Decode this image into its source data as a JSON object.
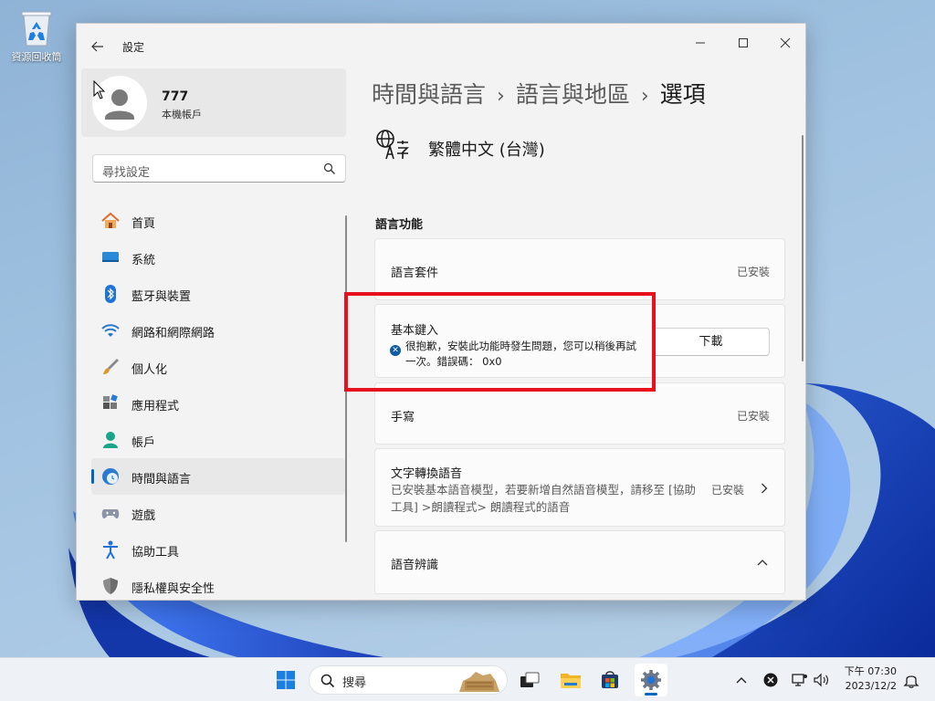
{
  "desktop": {
    "recycle_bin_label": "資源回收筒"
  },
  "window": {
    "app_title": "設定",
    "profile": {
      "name": "777",
      "subtitle": "本機帳戶"
    },
    "search_placeholder": "尋找設定",
    "nav": [
      {
        "label": "首頁",
        "icon": "home-icon",
        "active": false
      },
      {
        "label": "系統",
        "icon": "system-icon",
        "active": false
      },
      {
        "label": "藍牙與裝置",
        "icon": "bluetooth-icon",
        "active": false
      },
      {
        "label": "網路和網際網路",
        "icon": "wifi-icon",
        "active": false
      },
      {
        "label": "個人化",
        "icon": "brush-icon",
        "active": false
      },
      {
        "label": "應用程式",
        "icon": "apps-icon",
        "active": false
      },
      {
        "label": "帳戶",
        "icon": "account-icon",
        "active": false
      },
      {
        "label": "時間與語言",
        "icon": "time-language-icon",
        "active": true
      },
      {
        "label": "遊戲",
        "icon": "gamepad-icon",
        "active": false
      },
      {
        "label": "協助工具",
        "icon": "accessibility-icon",
        "active": false
      },
      {
        "label": "隱私權與安全性",
        "icon": "shield-icon",
        "active": false
      }
    ],
    "breadcrumb": {
      "part1": "時間與語言",
      "part2": "語言與地區",
      "current": "選項",
      "separator": "›"
    },
    "language_name": "繁體中文 (台灣)",
    "section_title": "語言功能",
    "features": {
      "language_pack": {
        "title": "語言套件",
        "status": "已安裝"
      },
      "basic_typing": {
        "title": "基本鍵入",
        "error": "很抱歉，安裝此功能時發生問題，您可以稍後再試一次。錯誤碼： 0x0",
        "button": "下載"
      },
      "handwriting": {
        "title": "手寫",
        "status": "已安裝"
      },
      "tts": {
        "title": "文字轉換語音",
        "desc": "已安裝基本語音模型，若要新增自然語音模型，請移至 [協助工具] >朗讀程式> 朗讀程式的語音",
        "status": "已安裝"
      },
      "speech": {
        "title": "語音辨識"
      }
    }
  },
  "taskbar": {
    "search_placeholder": "搜尋",
    "time": "下午 07:30",
    "date": "2023/12/2"
  },
  "colors": {
    "accent": "#0067c0",
    "highlight_box": "#e8101c"
  }
}
